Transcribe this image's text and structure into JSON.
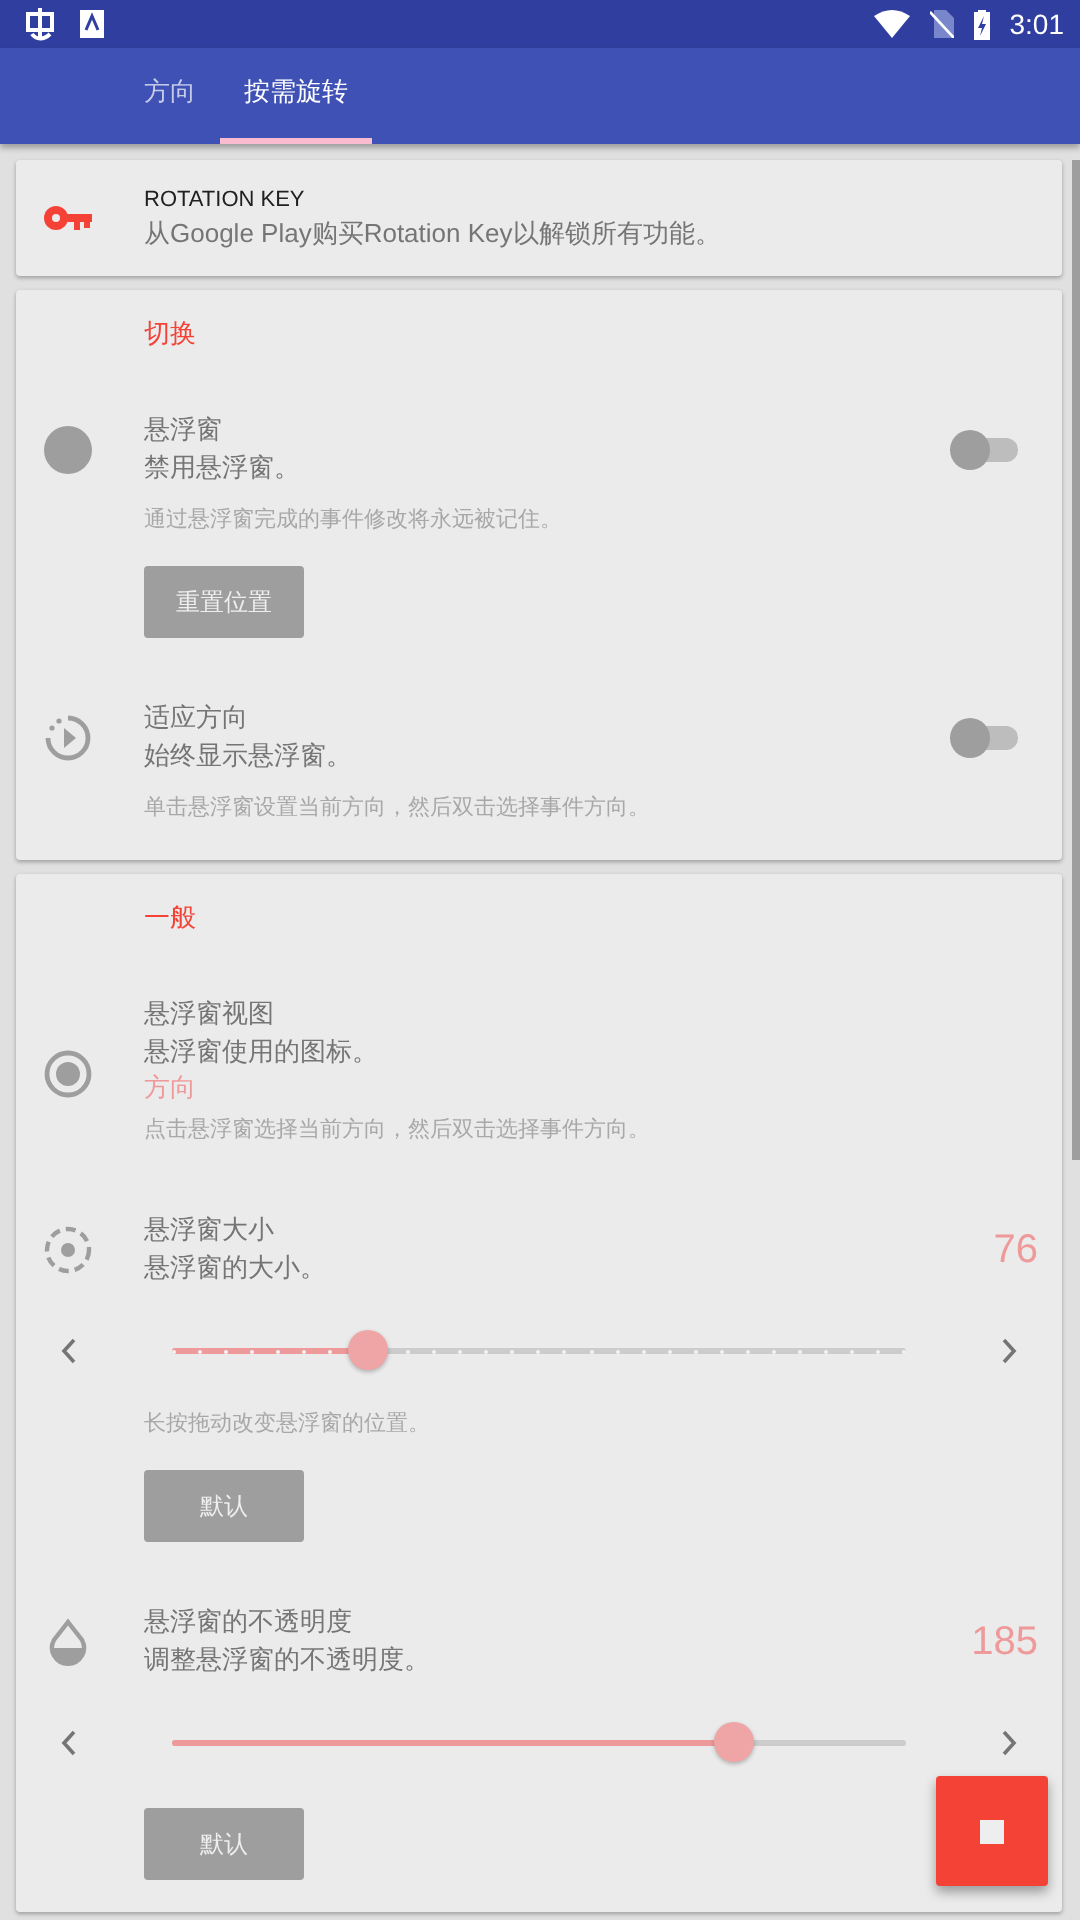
{
  "status_bar": {
    "time": "3:01"
  },
  "tabs": [
    {
      "label": "方向",
      "selected": false
    },
    {
      "label": "按需旋转",
      "selected": true
    }
  ],
  "key_card": {
    "title": "ROTATION KEY",
    "description": "从Google Play购买Rotation Key以解锁所有功能。"
  },
  "sections": [
    {
      "header": "切换",
      "items": [
        {
          "kind": "toggle",
          "title": "悬浮窗",
          "summary": "禁用悬浮窗。",
          "on": false,
          "note": "通过悬浮窗完成的事件修改将永远被记住。",
          "button": "重置位置"
        },
        {
          "kind": "toggle",
          "title": "适应方向",
          "summary": "始终显示悬浮窗。",
          "on": false,
          "note": "单击悬浮窗设置当前方向，然后双击选择事件方向。"
        }
      ]
    },
    {
      "header": "一般",
      "items": [
        {
          "kind": "choice",
          "title": "悬浮窗视图",
          "summary": "悬浮窗使用的图标。",
          "value": "方向",
          "note": "点击悬浮窗选择当前方向，然后双击选择事件方向。"
        },
        {
          "kind": "slider",
          "title": "悬浮窗大小",
          "summary": "悬浮窗的大小。",
          "reading": "76",
          "level": 0.253,
          "stepped": true,
          "note": "长按拖动改变悬浮窗的位置。",
          "button": "默认"
        },
        {
          "kind": "slider",
          "title": "悬浮窗的不透明度",
          "summary": "调整悬浮窗的不透明度。",
          "reading": "185",
          "level": 0.725,
          "stepped": false,
          "button": "默认"
        }
      ]
    }
  ]
}
